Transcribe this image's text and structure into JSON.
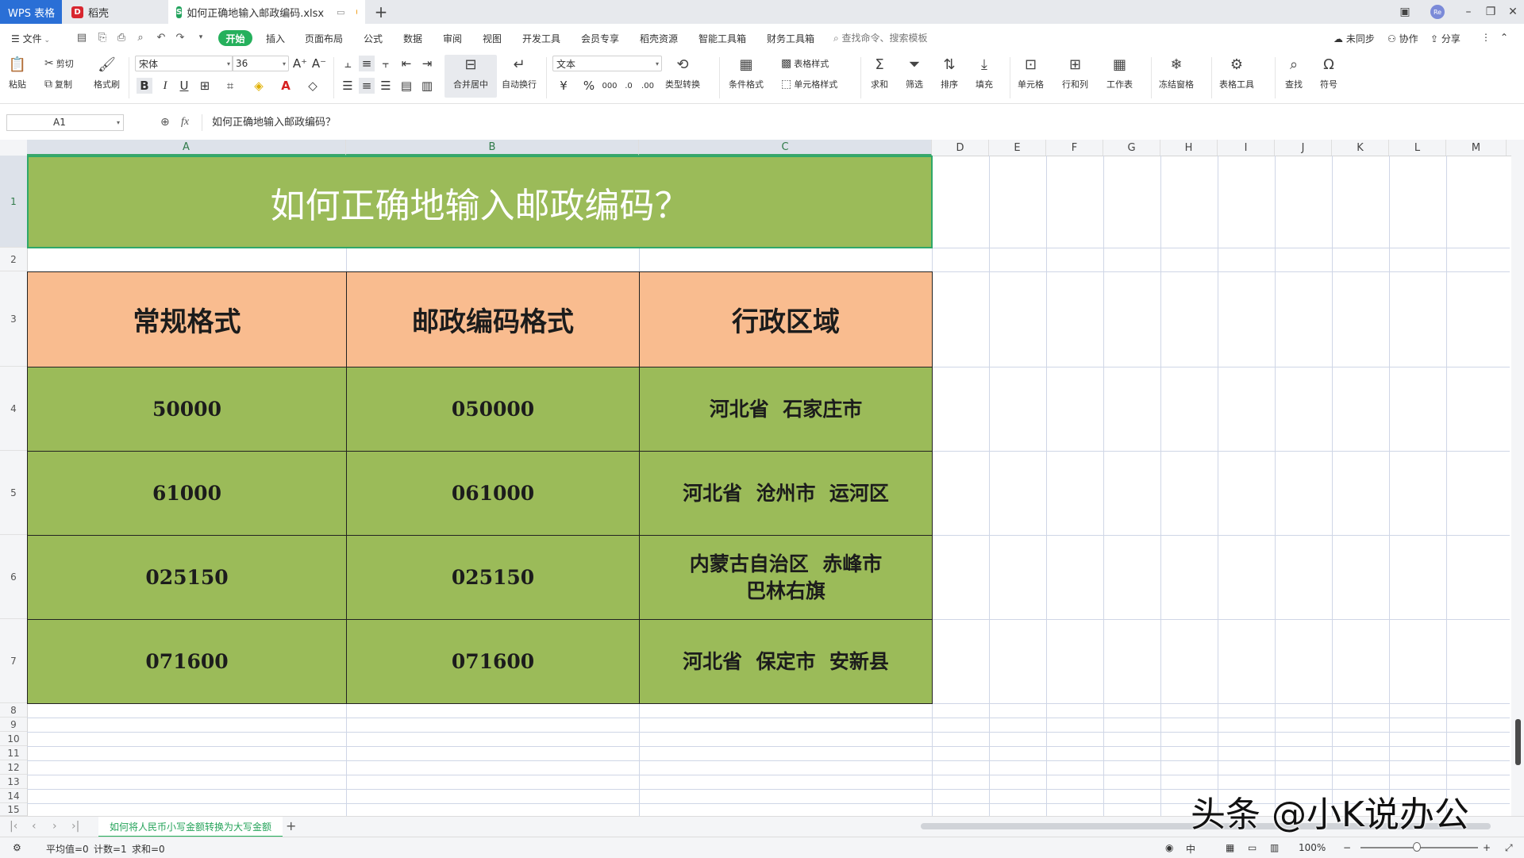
{
  "tabs": {
    "wps": "WPS 表格",
    "daoke": "稻壳",
    "file": "如何正确地输入邮政编码.xlsx"
  },
  "menu": {
    "file": "文件",
    "items": [
      "开始",
      "插入",
      "页面布局",
      "公式",
      "数据",
      "审阅",
      "视图",
      "开发工具",
      "会员专享",
      "稻壳资源",
      "智能工具箱",
      "财务工具箱"
    ],
    "search_placeholder": "查找命令、搜索模板",
    "sync": "未同步",
    "collab": "协作",
    "share": "分享"
  },
  "ribbon": {
    "paste": "粘贴",
    "cut": "剪切",
    "copy": "复制",
    "format_painter": "格式刷",
    "font_name": "宋体",
    "font_size": "36",
    "merge_center": "合并居中",
    "auto_wrap": "自动换行",
    "number_format": "文本",
    "type_convert": "类型转换",
    "cond_format": "条件格式",
    "table_style": "表格样式",
    "cell_style": "单元格样式",
    "sum": "求和",
    "filter": "筛选",
    "sort": "排序",
    "fill": "填充",
    "cell": "单元格",
    "row_col": "行和列",
    "worksheet": "工作表",
    "freeze": "冻结窗格",
    "table_tools": "表格工具",
    "find": "查找",
    "symbol": "符号"
  },
  "formula_bar": {
    "name_box": "A1",
    "fx": "fx",
    "content": "如何正确地输入邮政编码？"
  },
  "columns": [
    "A",
    "B",
    "C",
    "D",
    "E",
    "F",
    "G",
    "H",
    "I",
    "J",
    "K",
    "L",
    "M"
  ],
  "rows": [
    "1",
    "2",
    "3",
    "4",
    "5",
    "6",
    "7",
    "8",
    "9",
    "10",
    "11",
    "12",
    "13",
    "14",
    "15"
  ],
  "sheet": {
    "title": "如何正确地输入邮政编码？",
    "headers": [
      "常规格式",
      "邮政编码格式",
      "行政区域"
    ],
    "data": [
      [
        "50000",
        "050000",
        "河北省  石家庄市"
      ],
      [
        "61000",
        "061000",
        "河北省  沧州市  运河区"
      ],
      [
        "025150",
        "025150",
        "内蒙古自治区  赤峰市\n巴林右旗"
      ],
      [
        "071600",
        "071600",
        "河北省  保定市  安新县"
      ]
    ]
  },
  "sheet_tab": "如何将人民币小写金额转换为大写金额",
  "status": {
    "average": "平均值=0",
    "count": "计数=1",
    "sum": "求和=0",
    "zoom": "100%"
  },
  "watermark": "头条 @小K说办公",
  "colors": {
    "title_fill": "#9bbb59",
    "header_fill": "#f9bc8f",
    "data_fill": "#9bbb59",
    "accent": "#25b05c"
  }
}
